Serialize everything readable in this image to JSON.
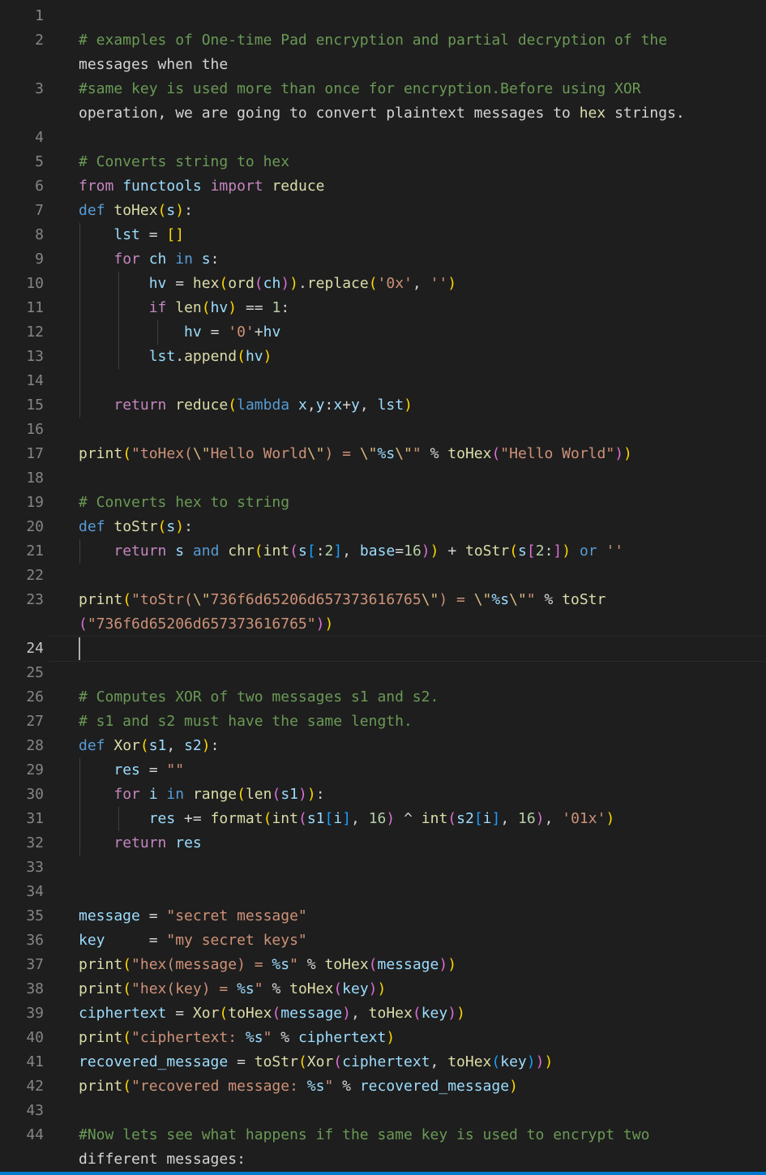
{
  "editor": {
    "language": "python",
    "active_line": 24,
    "line_numbers": [
      "1",
      "2",
      "",
      "3",
      "",
      "4",
      "5",
      "6",
      "7",
      "8",
      "9",
      "10",
      "11",
      "12",
      "13",
      "14",
      "15",
      "16",
      "17",
      "18",
      "19",
      "20",
      "21",
      "22",
      "23",
      "",
      "24",
      "25",
      "26",
      "27",
      "28",
      "29",
      "30",
      "31",
      "32",
      "33",
      "34",
      "35",
      "36",
      "37",
      "38",
      "39",
      "40",
      "41",
      "42",
      "43",
      "44",
      ""
    ],
    "lines": [
      "",
      "# examples of One-time Pad encryption and partial decryption of the",
      "messages when the",
      "#same key is used more than once for encryption.Before using XOR",
      "operation, we are going to convert plaintext messages to hex strings.",
      "",
      "# Converts string to hex",
      "from functools import reduce",
      "def toHex(s):",
      "    lst = []",
      "    for ch in s:",
      "        hv = hex(ord(ch)).replace('0x', '')",
      "        if len(hv) == 1:",
      "            hv = '0'+hv",
      "        lst.append(hv)",
      "",
      "    return reduce(lambda x,y:x+y, lst)",
      "",
      "print(\"toHex(\\\"Hello World\\\") = \\\"%s\\\"\" % toHex(\"Hello World\"))",
      "",
      "# Converts hex to string",
      "def toStr(s):",
      "    return s and chr(int(s[:2], base=16)) + toStr(s[2:]) or ''",
      "",
      "print(\"toStr(\\\"736f6d65206d657373616765\\\") = \\\"%s\\\"\" % toStr",
      "(\"736f6d65206d657373616765\"))",
      "",
      "",
      "# Computes XOR of two messages s1 and s2.",
      "# s1 and s2 must have the same length.",
      "def Xor(s1, s2):",
      "    res = \"\"",
      "    for i in range(len(s1)):",
      "        res += format(int(s1[i], 16) ^ int(s2[i], 16), '01x')",
      "    return res",
      "",
      "",
      "message = \"secret message\"",
      "key     = \"my secret keys\"",
      "print(\"hex(message) = %s\" % toHex(message))",
      "print(\"hex(key) = %s\" % toHex(key))",
      "ciphertext = Xor(toHex(message), toHex(key))",
      "print(\"ciphertext: %s\" % ciphertext)",
      "recovered_message = toStr(Xor(ciphertext, toHex(key)))",
      "print(\"recovered message: %s\" % recovered_message)",
      "",
      "#Now lets see what happens if the same key is used to encrypt two",
      "different messages:"
    ]
  }
}
